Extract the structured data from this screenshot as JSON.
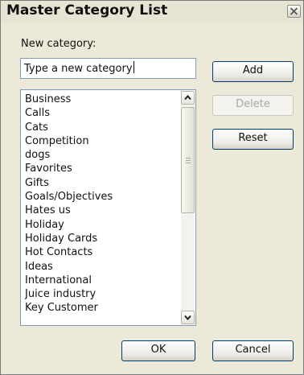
{
  "dialog": {
    "title": "Master Category List",
    "new_category_label": "New category:",
    "new_category_input_value": "Type a new category",
    "buttons": {
      "add": "Add",
      "delete": "Delete",
      "reset": "Reset",
      "ok": "OK",
      "cancel": "Cancel"
    },
    "categories": [
      "Business",
      "Calls",
      "Cats",
      "Competition",
      "dogs",
      "Favorites",
      "Gifts",
      "Goals/Objectives",
      "Hates us",
      "Holiday",
      "Holiday Cards",
      "Hot Contacts",
      "Ideas",
      "International",
      "Juice industry",
      "Key Customer"
    ],
    "icons": {
      "close": "close-icon",
      "scroll_up": "chevron-up-icon",
      "scroll_down": "chevron-down-icon"
    }
  }
}
